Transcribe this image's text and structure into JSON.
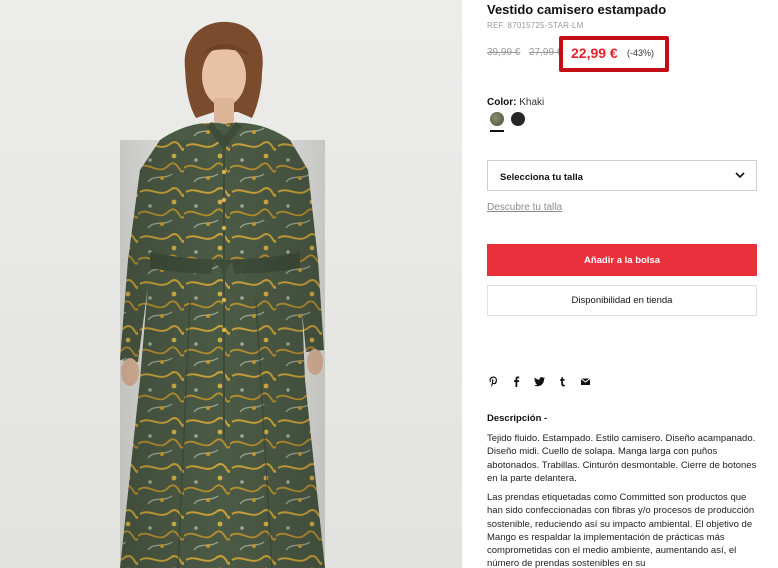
{
  "product": {
    "title": "Vestido camisero estampado",
    "ref": "REF. 87015725-STAR-LM",
    "old_price_1": "39,99 €",
    "old_price_2": "27,99 €",
    "current_price": "22,99 €",
    "discount": "(-43%)"
  },
  "color": {
    "label": "Color:",
    "selected": "Khaki",
    "swatches": [
      {
        "name": "khaki",
        "hex": "#5c6448"
      },
      {
        "name": "black",
        "hex": "#262626"
      }
    ]
  },
  "size": {
    "placeholder": "Selecciona tu talla",
    "guide_link": "Descubre tu talla"
  },
  "actions": {
    "add_to_bag": "Añadir a la bolsa",
    "store_availability": "Disponibilidad en tienda"
  },
  "share_icons": [
    "pinterest-icon",
    "facebook-icon",
    "twitter-icon",
    "tumblr-icon",
    "email-icon"
  ],
  "description": {
    "heading": "Descripción -",
    "paragraph_1": "Tejido fluido. Estampado. Estilo camisero. Diseño acampanado. Diseño midi. Cuello de solapa. Manga larga con puños abotonados. Trabillas. Cinturón desmontable. Cierre de botones en la parte delantera.",
    "paragraph_2": "Las prendas etiquetadas como Committed son productos que han sido confeccionadas con fibras y/o procesos de producción sostenible, reduciendo así su impacto ambiental. El objetivo de Mango es respaldar la implementación de prácticas más comprometidas con el medio ambiente, aumentando así, el número de prendas sostenibles en su"
  },
  "colors": {
    "price_red": "#e0232e",
    "highlight_border": "#c50f16",
    "button_red": "#e8313d",
    "muted_text": "#9a9a9a"
  }
}
